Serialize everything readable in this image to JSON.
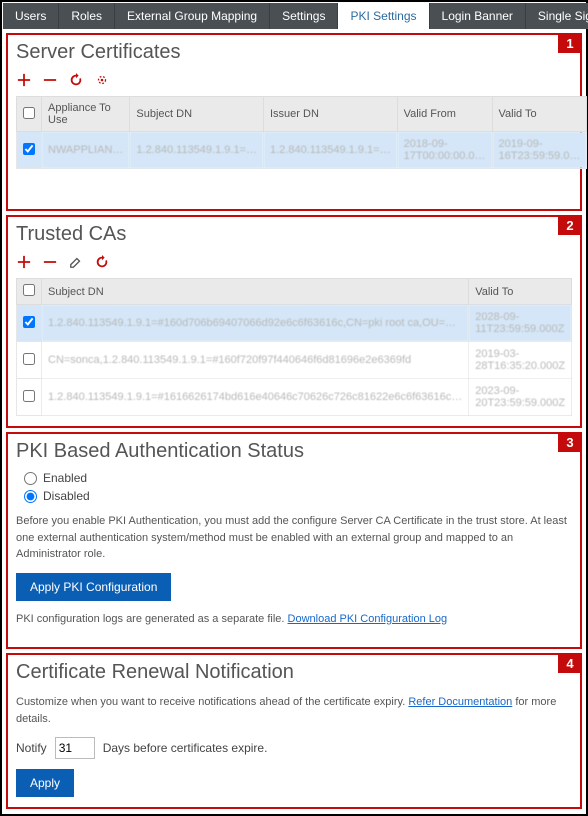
{
  "tabs": {
    "items": [
      {
        "label": "Users"
      },
      {
        "label": "Roles"
      },
      {
        "label": "External Group Mapping"
      },
      {
        "label": "Settings"
      },
      {
        "label": "PKI Settings"
      },
      {
        "label": "Login Banner"
      },
      {
        "label": "Single Sign-On Settings"
      }
    ],
    "active_index": 4
  },
  "panel1": {
    "number": "1",
    "title": "Server Certificates",
    "columns": {
      "appliance": "Appliance To Use",
      "subject": "Subject DN",
      "issuer": "Issuer DN",
      "valid_from": "Valid From",
      "valid_to": "Valid To"
    },
    "rows": [
      {
        "checked": true,
        "appliance": "NWAPPLIAN…",
        "subject": "1.2.840.113549.1.9.1=…",
        "issuer": "1.2.840.113549.1.9.1=…",
        "valid_from": "2018-09-17T00:00:00.0…",
        "valid_to": "2019-09-16T23:59:59.0…"
      }
    ]
  },
  "panel2": {
    "number": "2",
    "title": "Trusted CAs",
    "columns": {
      "subject": "Subject DN",
      "valid_to": "Valid To"
    },
    "rows": [
      {
        "checked": true,
        "subject": "1.2.840.113549.1.9.1=#160d706b69407066d92e6c6f63616c,CN=pki root ca,OU=…",
        "valid_to": "2028-09-11T23:59:59.000Z"
      },
      {
        "checked": false,
        "subject": "CN=sonca,1.2.840.113549.1.9.1=#160f720f97f440646f6d81696e2e6369fd",
        "valid_to": "2019-03-28T16:35:20.000Z"
      },
      {
        "checked": false,
        "subject": "1.2.840.113549.1.9.1=#1616626174bd616e40646c70626c726c81622e6c6f63616c…",
        "valid_to": "2023-09-20T23:59:59.000Z"
      }
    ]
  },
  "panel3": {
    "number": "3",
    "title": "PKI Based Authentication Status",
    "radio": {
      "enabled": "Enabled",
      "disabled": "Disabled",
      "selected": "disabled"
    },
    "note": "Before you enable PKI Authentication, you must add the configure Server CA Certificate in the trust store. At least one external authentication system/method must be enabled with an external group and mapped to an Administrator role.",
    "apply": "Apply PKI Configuration",
    "log_prefix": "PKI configuration logs are generated as a separate file. ",
    "log_link": "Download PKI Configuration Log"
  },
  "panel4": {
    "number": "4",
    "title": "Certificate Renewal Notification",
    "note_pre": "Customize when you want to receive notifications ahead of the certificate expiry. ",
    "note_link": "Refer Documentation",
    "note_post": " for more details.",
    "notify_label": "Notify",
    "notify_value": 31,
    "notify_suffix": "Days before certificates expire.",
    "apply": "Apply"
  }
}
